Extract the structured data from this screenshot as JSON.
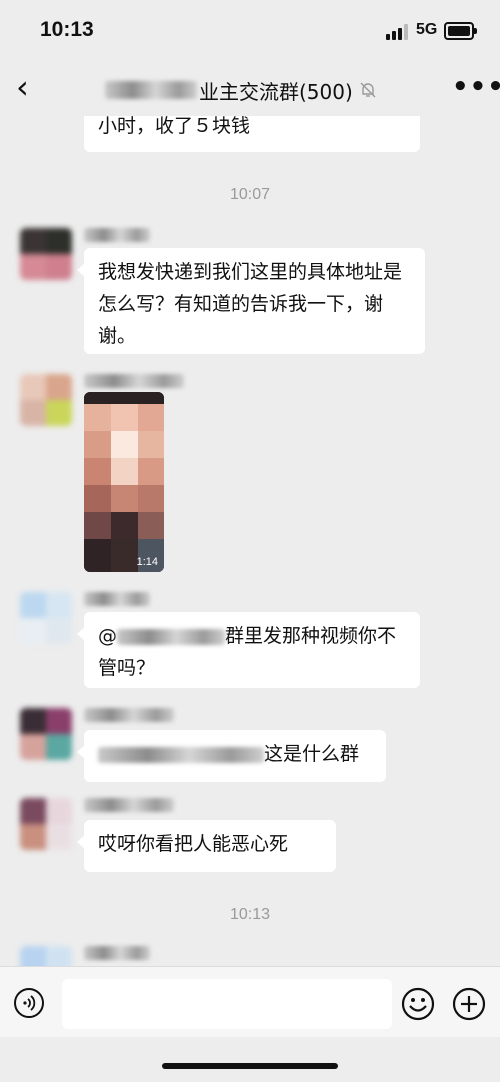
{
  "status_bar": {
    "time": "10:13",
    "network": "5G",
    "icons": [
      "signal-icon",
      "battery-icon"
    ]
  },
  "header": {
    "back_icon": "chevron-left-icon",
    "title": "业主交流群(500)",
    "mute_icon": "bell-mute-icon",
    "more_label": "•••"
  },
  "messages": [
    {
      "type": "text",
      "text": "小时，收了５块钱"
    },
    {
      "type": "timestamp",
      "text": "10:07"
    },
    {
      "type": "text",
      "text": "我想发快递到我们这里的具体地址是怎么写？有知道的告诉我一下，谢谢。"
    },
    {
      "type": "video",
      "duration": "1:14"
    },
    {
      "type": "text",
      "prefix": "@",
      "text": "群里发那种视频你不管吗？"
    },
    {
      "type": "text",
      "text": "这是什么群"
    },
    {
      "type": "text",
      "text": "哎呀你看把人能恶心死"
    },
    {
      "type": "timestamp",
      "text": "10:13"
    }
  ],
  "input_bar": {
    "voice_icon": "voice-icon",
    "emoji_icon": "emoji-icon",
    "plus_icon": "plus-icon",
    "placeholder": ""
  }
}
